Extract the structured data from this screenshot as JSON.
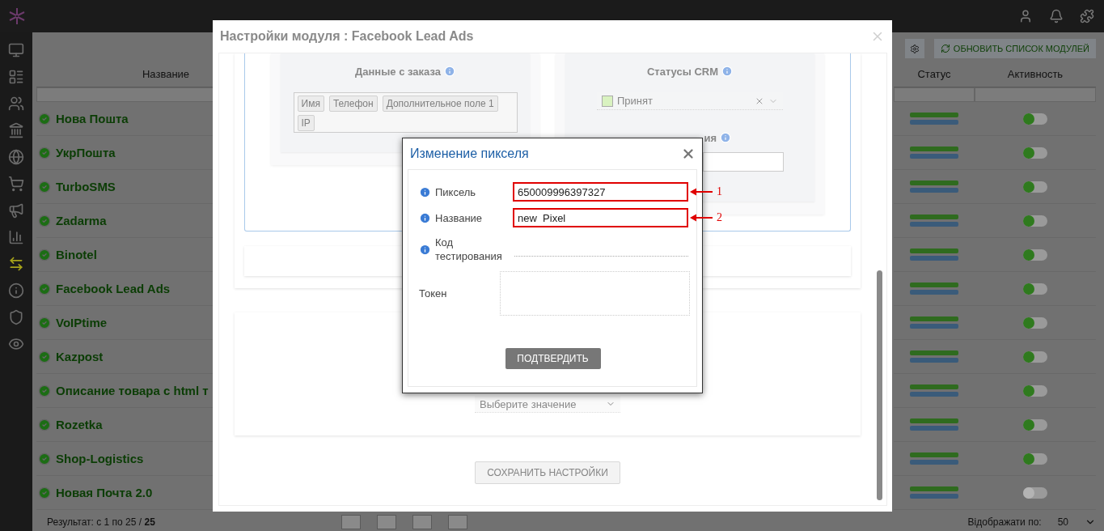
{
  "toolbar": {
    "refresh_button": "ОБНОВИТЬ СПИСОК МОДУЛЕЙ"
  },
  "table": {
    "columns": [
      "Название",
      "Статус",
      "Активность"
    ],
    "rows": [
      {
        "name": "Нова Пошта",
        "active": true
      },
      {
        "name": "УкрПошта",
        "active": true
      },
      {
        "name": "TurboSMS",
        "active": true
      },
      {
        "name": "Zadarma",
        "active": true
      },
      {
        "name": "Binotel",
        "active": true
      },
      {
        "name": "Facebook Lead Ads",
        "active": true
      },
      {
        "name": "VoIPtime",
        "active": true
      },
      {
        "name": "Kazpost",
        "active": true
      },
      {
        "name": "Описание товара с html т",
        "active": true
      },
      {
        "name": "Rozetka",
        "active": true
      },
      {
        "name": "Shop-Logistics",
        "active": true
      },
      {
        "name": "Новая Почта 2.0",
        "active": false
      }
    ]
  },
  "footer": {
    "result_prefix": "Результат: с 1 по 25 / ",
    "result_total": "25",
    "per_page_label": "Відображати по:",
    "per_page": "50"
  },
  "settings_modal": {
    "title": "Настройки модуля : Facebook Lead Ads",
    "order_data": {
      "heading": "Данные с заказа",
      "tags": [
        "Имя",
        "Телефон",
        "Дополнительное поле 1",
        "IP"
      ]
    },
    "crm": {
      "heading": "Статусы CRM",
      "status": "Принят",
      "second_heading": "ия"
    },
    "select_placeholder": "Выберите значение",
    "save_button": "СОХРАНИТЬ НАСТРОЙКИ"
  },
  "pixel_modal": {
    "title": "Изменение пикселя",
    "fields": [
      {
        "kind": "input",
        "label": "Пиксель",
        "value": "650009996397327",
        "info": true,
        "annotation": "1"
      },
      {
        "kind": "input",
        "label": "Название",
        "value": "new  Pixel",
        "info": true,
        "annotation": "2"
      },
      {
        "kind": "line",
        "label": "Код тестирования",
        "info": true
      },
      {
        "kind": "textarea",
        "label": "Токен",
        "info": false
      }
    ],
    "confirm_button": "ПОДТВЕРДИТЬ"
  }
}
